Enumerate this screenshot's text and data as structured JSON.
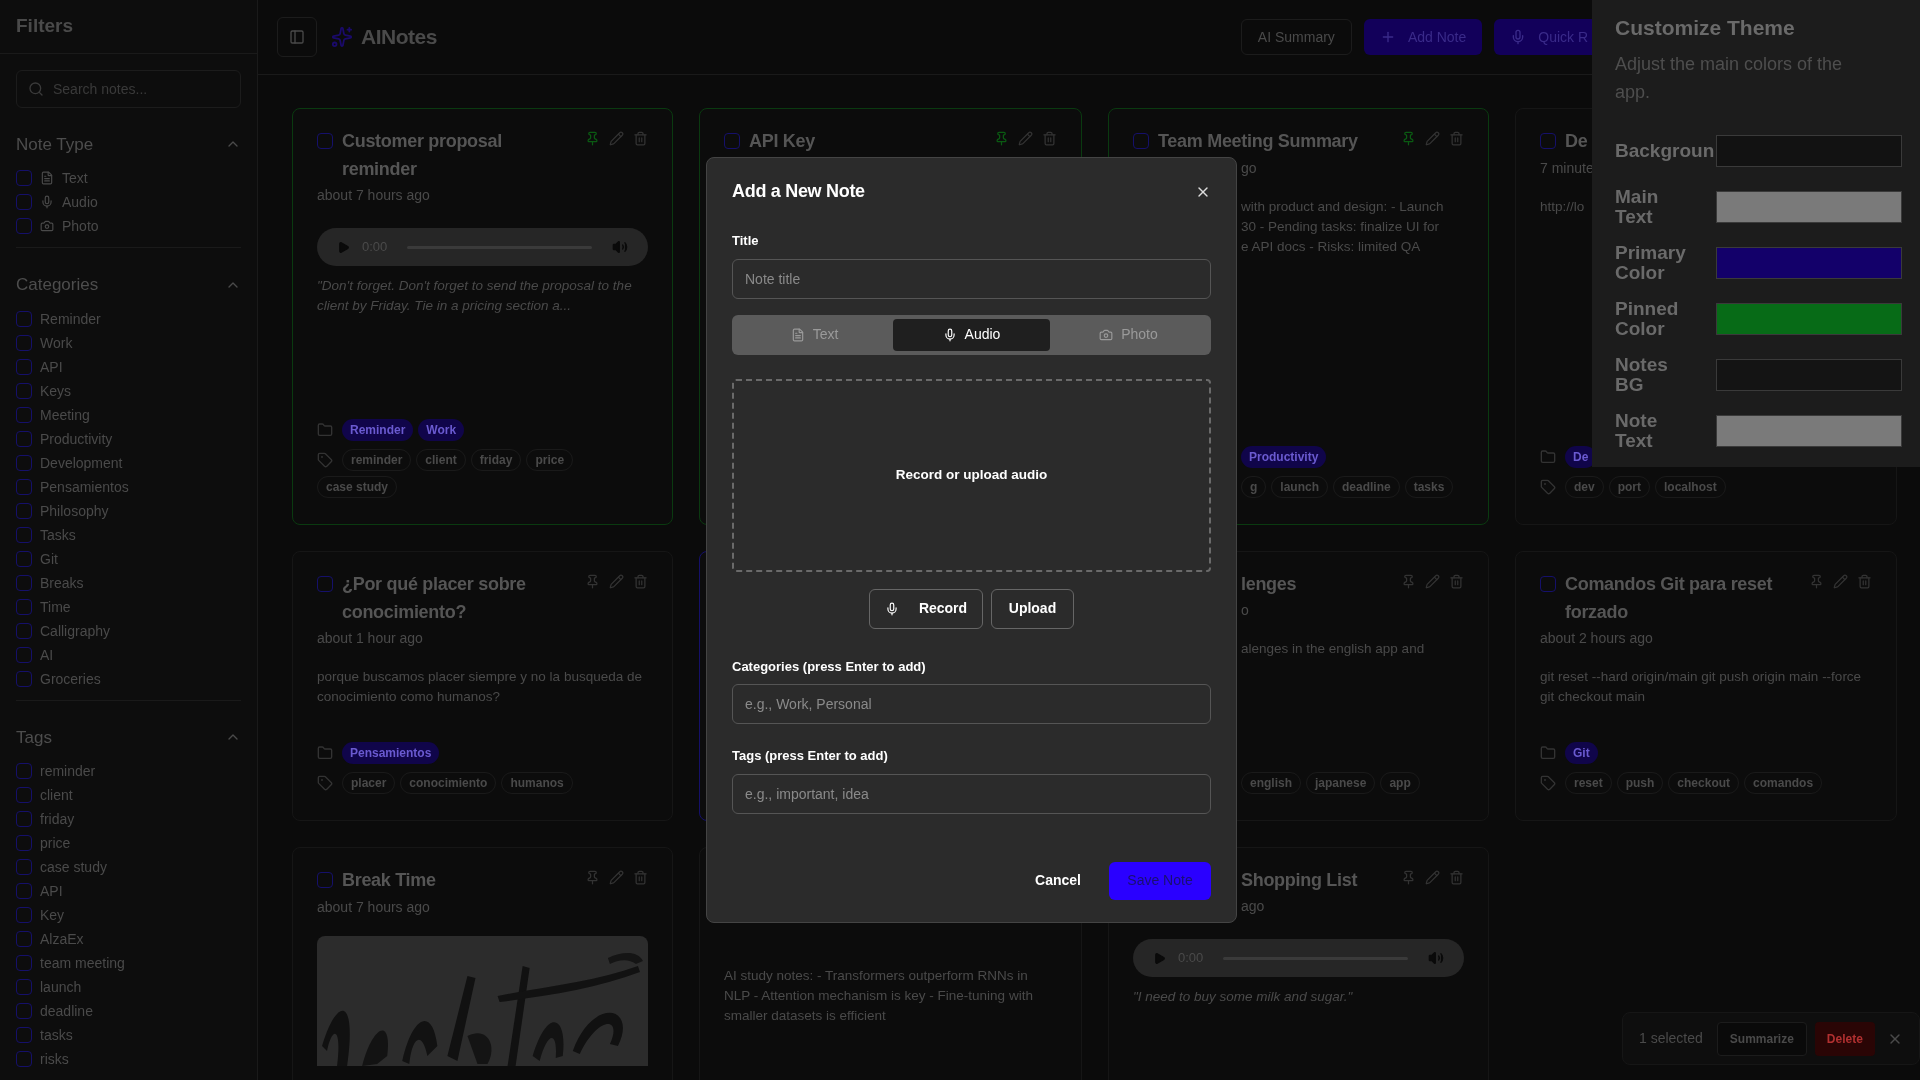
{
  "sidebar": {
    "title": "Filters",
    "search": {
      "placeholder": "Search notes..."
    },
    "sections": [
      {
        "title": "Note Type",
        "expanded": true,
        "items": [
          {
            "label": "Text",
            "kind": "text",
            "checked": false
          },
          {
            "label": "Audio",
            "kind": "audio",
            "checked": false
          },
          {
            "label": "Photo",
            "checked": false
          }
        ]
      },
      {
        "title": "Categories",
        "expanded": true,
        "items": [
          {
            "label": "Reminder",
            "checked": false
          },
          {
            "label": "Work",
            "checked": false
          },
          {
            "label": "API",
            "checked": false
          },
          {
            "label": "Keys",
            "checked": false
          },
          {
            "label": "Meeting",
            "checked": false
          },
          {
            "label": "Productivity",
            "checked": false
          },
          {
            "label": "Development",
            "checked": false
          },
          {
            "label": "Pensamientos",
            "checked": false
          },
          {
            "label": "Philosophy",
            "checked": false
          },
          {
            "label": "Tasks",
            "checked": false
          },
          {
            "label": "Git",
            "checked": false
          },
          {
            "label": "Breaks",
            "checked": false
          },
          {
            "label": "Time",
            "checked": false
          },
          {
            "label": "Calligraphy",
            "checked": false
          },
          {
            "label": "AI",
            "checked": false
          },
          {
            "label": "Groceries",
            "checked": false
          }
        ]
      },
      {
        "title": "Tags",
        "expanded": true,
        "items": [
          {
            "label": "reminder",
            "checked": false
          },
          {
            "label": "client",
            "checked": false
          },
          {
            "label": "friday",
            "checked": false
          },
          {
            "label": "price",
            "checked": false
          },
          {
            "label": "case study",
            "checked": false
          },
          {
            "label": "API",
            "checked": false
          },
          {
            "label": "Key",
            "checked": false
          },
          {
            "label": "AlzaEx",
            "checked": false
          },
          {
            "label": "team meeting",
            "checked": false
          },
          {
            "label": "launch",
            "checked": false
          },
          {
            "label": "deadline",
            "checked": false
          },
          {
            "label": "tasks",
            "checked": false
          },
          {
            "label": "risks",
            "checked": false
          }
        ]
      }
    ]
  },
  "header": {
    "title": "AINotes",
    "buttons": [
      {
        "label": "AI Summary",
        "kind": "outline"
      },
      {
        "label": "Add Note",
        "kind": "add"
      },
      {
        "label": "Quick R",
        "kind": "record"
      }
    ]
  },
  "notes": [
    {
      "pinned": true,
      "selected": false,
      "blocks": [
        {
          "kind": "head",
          "title": "Customer proposal reminder",
          "actions": true
        },
        {
          "kind": "time",
          "text": "about 7 hours ago"
        },
        {
          "kind": "audio",
          "time": "0:00"
        },
        {
          "kind": "quote",
          "text": "\"Don't forget. Don't forget to send the proposal to the client by Friday. Tie in a pricing section a..."
        },
        {
          "kind": "categories",
          "items": [
            "Reminder",
            "Work"
          ]
        },
        {
          "kind": "tags",
          "items": [
            "reminder",
            "client",
            "friday",
            "price",
            "case study"
          ]
        }
      ]
    },
    {
      "pinned": true,
      "selected": false,
      "blocks": [
        {
          "kind": "head",
          "title": "API Key",
          "actions": true
        }
      ]
    },
    {
      "pinned": true,
      "selected": false,
      "blocks": [
        {
          "kind": "head",
          "title": "Team Meeting Summary",
          "actions": true
        },
        {
          "kind": "time",
          "text": "go",
          "shifted": true
        },
        {
          "kind": "body",
          "lines": [
            "with product and design: - Launch",
            "30 - Pending tasks: finalize UI for",
            "e API docs - Risks: limited QA"
          ],
          "shifted": true
        },
        {
          "kind": "categories",
          "items": [
            "Productivity"
          ],
          "shifted": true
        },
        {
          "kind": "tags",
          "items": [
            "g",
            "launch",
            "deadline",
            "tasks"
          ],
          "shifted": true
        }
      ]
    },
    {
      "pinned": false,
      "selected": false,
      "blocks": [
        {
          "kind": "head",
          "title": "De",
          "actions": false
        },
        {
          "kind": "time",
          "text": "7 minute"
        },
        {
          "kind": "body",
          "text": "http://lo"
        },
        {
          "kind": "categories",
          "items": [
            "De"
          ]
        },
        {
          "kind": "tags",
          "items": [
            "dev",
            "port",
            "localhost"
          ]
        }
      ]
    },
    {
      "pinned": false,
      "selected": false,
      "blocks": [
        {
          "kind": "head",
          "title": "¿Por qué placer sobre conocimiento?",
          "actions": true
        },
        {
          "kind": "time",
          "text": "about 1 hour ago"
        },
        {
          "kind": "body",
          "text": "porque buscamos placer siempre y no la busqueda de conocimiento como humanos?"
        },
        {
          "kind": "categories",
          "items": [
            "Pensamientos"
          ]
        },
        {
          "kind": "tags",
          "items": [
            "placer",
            "conocimiento",
            "humanos"
          ]
        }
      ]
    },
    {
      "pinned": false,
      "selected": true
    },
    {
      "pinned": false,
      "selected": false,
      "blocks": [
        {
          "kind": "head",
          "title": "lenges",
          "actions": true,
          "shifted": true
        },
        {
          "kind": "time",
          "text": "o",
          "shifted": true
        },
        {
          "kind": "body",
          "text": "alenges in the english app and",
          "shifted": true
        },
        {
          "kind": "tags",
          "items": [
            "english",
            "japanese",
            "app"
          ],
          "shifted": true
        }
      ]
    },
    {
      "pinned": false,
      "selected": false,
      "blocks": [
        {
          "kind": "head",
          "title": "Comandos Git para reset forzado",
          "actions": true
        },
        {
          "kind": "time",
          "text": "about 2 hours ago"
        },
        {
          "kind": "body",
          "text": "git reset --hard origin/main git push origin main --force git checkout main"
        },
        {
          "kind": "categories",
          "items": [
            "Git"
          ]
        },
        {
          "kind": "tags",
          "items": [
            "reset",
            "push",
            "checkout",
            "comandos"
          ]
        }
      ]
    },
    {
      "pinned": false,
      "selected": false,
      "blocks": [
        {
          "kind": "head",
          "title": "Break Time",
          "actions": true
        },
        {
          "kind": "time",
          "text": "about 7 hours ago"
        },
        {
          "kind": "picture"
        }
      ]
    },
    {
      "pinned": false,
      "selected": false,
      "top_hidden": true,
      "blocks": [
        {
          "kind": "body",
          "text": "AI study notes: - Transformers outperform RNNs in NLP - Attention mechanism is key - Fine-tuning with smaller datasets is efficient"
        }
      ]
    },
    {
      "pinned": false,
      "selected": false,
      "blocks": [
        {
          "kind": "head",
          "title": "Shopping List",
          "actions": true,
          "shifted": true
        },
        {
          "kind": "time",
          "text": "ago",
          "shifted": true
        },
        {
          "kind": "audio",
          "time": "0:00"
        },
        {
          "kind": "quote",
          "text": "\"I need to buy some milk and sugar.\""
        }
      ]
    }
  ],
  "theme": {
    "title": "Customize Theme",
    "subtitle": "Adjust the main colors of the app.",
    "rows": [
      {
        "label": "Backgroun",
        "color": "#121212"
      },
      {
        "label": "Main Text",
        "color": "#7a7a7a"
      },
      {
        "label": "Primary Color",
        "color": "#13006a"
      },
      {
        "label": "Pinned Color",
        "color": "#076b17"
      },
      {
        "label": "Notes BG",
        "color": "#141414"
      },
      {
        "label": "Note Text",
        "color": "#7a7a7a"
      }
    ]
  },
  "dialog": {
    "title": "Add a New Note",
    "title_label": "Title",
    "title_placeholder": "Note title",
    "tabs": [
      {
        "label": "Text",
        "kind": "text",
        "selected": false
      },
      {
        "label": "Audio",
        "kind": "audio",
        "selected": true
      },
      {
        "label": "Photo",
        "selected": false
      }
    ],
    "dropzone": "Record or upload audio",
    "record": "Record",
    "upload": "Upload",
    "categories_label": "Categories (press Enter to add)",
    "categories_placeholder": "e.g., Work, Personal",
    "tags_label": "Tags (press Enter to add)",
    "tags_placeholder": "e.g., important, idea",
    "cancel": "Cancel",
    "save": "Save Note"
  },
  "selection_bar": {
    "count": "1 selected",
    "buttons": [
      {
        "label": "Summarize",
        "kind": "outline"
      },
      {
        "label": "Delete",
        "kind": "danger"
      }
    ]
  }
}
